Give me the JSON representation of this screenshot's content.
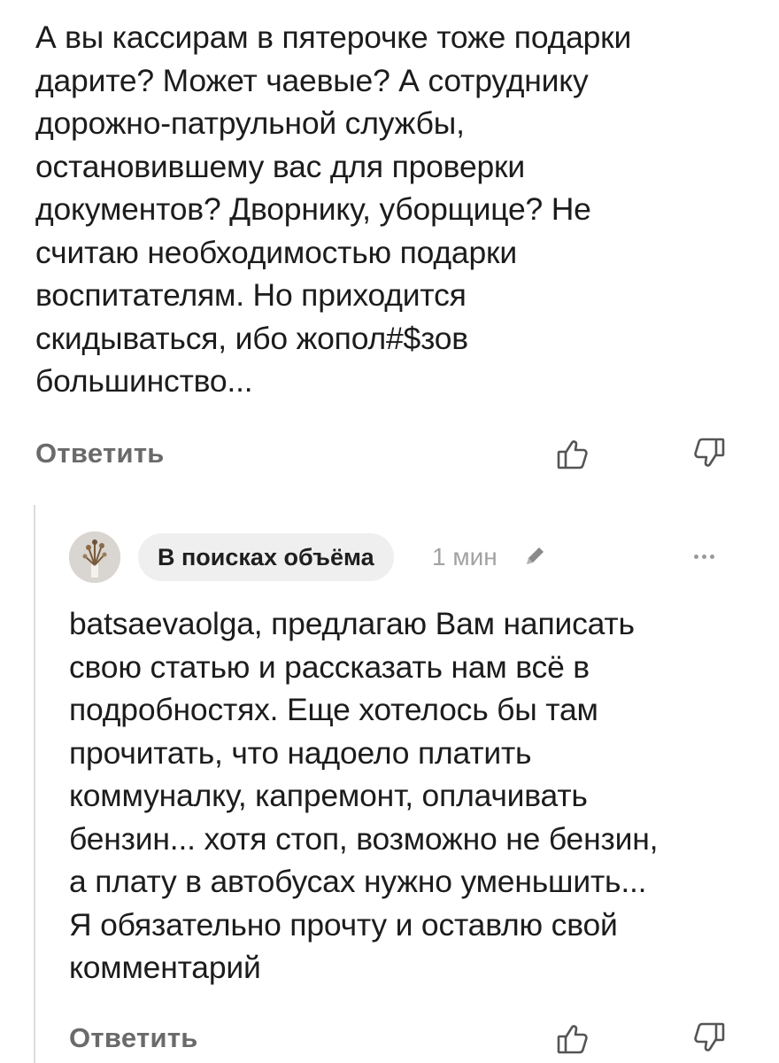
{
  "comment": {
    "text": "А вы кассирам в пятерочке тоже подарки\nдарите? Может чаевые? А сотруднику\nдорожно-патрульной службы,\nостановившему вас для проверки\nдокументов? Дворнику, уборщице?  Не\nсчитаю необходимостью подарки\nвоспитателям. Но приходится\nскидываться, ибо жопол#$зов\nбольшинство...",
    "reply_label": "Ответить",
    "like_icon": "thumbs-up-icon",
    "dislike_icon": "thumbs-down-icon"
  },
  "reply": {
    "author": "В поисках объёма",
    "time": "1 мин",
    "edit_icon": "pencil-icon",
    "more_icon": "more-dots-icon",
    "text": "batsaevaolga, предлагаю Вам написать\nсвою статью и рассказать нам всё в\nподробностях. Еще хотелось бы там\nпрочитать, что надоело платить\nкоммуналку, капремонт, оплачивать\nбензин... хотя стоп, возможно не бензин,\nа плату в автобусах нужно уменьшить...\nЯ обязательно прочту и оставлю свой\nкомментарий",
    "reply_label": "Ответить",
    "like_icon": "thumbs-up-icon",
    "dislike_icon": "thumbs-down-icon"
  },
  "colors": {
    "text": "#1c1c1c",
    "muted": "#6a6a6a",
    "timestamp": "#a2a2a2",
    "pill": "#efefef",
    "thread_line": "#dcdcdc"
  }
}
